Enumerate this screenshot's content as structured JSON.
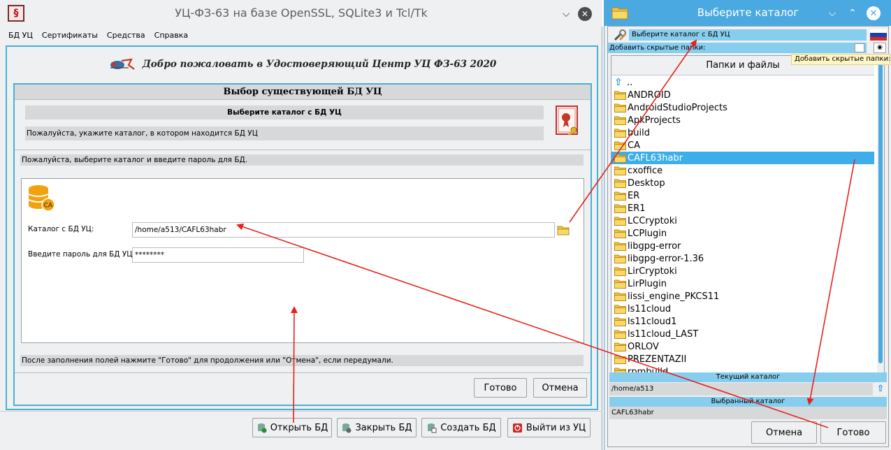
{
  "main_window": {
    "title": "УЦ-ФЗ-63 на базе OpenSSL, SQLite3 и Tcl/Tk",
    "menu": [
      "БД УЦ",
      "Сертификаты",
      "Средства",
      "Справка"
    ],
    "welcome": "Добро пожаловать в Удостоверяющий Центр УЦ ФЗ-63 2020",
    "group_title": "Выбор существующей БД УЦ",
    "hint_title": "Выберите каталог с БД УЦ",
    "hint_sub": "Пожалуйста, укажите каталог, в котором находится БД УЦ",
    "hint_sub2": "Пожалуйста, выберите каталог и введите пароль для БД.",
    "db_badge": "CA",
    "catalog_label": "Каталог с БД УЦ:",
    "catalog_value": "/home/a513/CAFL63habr",
    "password_label": "Введите пароль для БД УЦ:",
    "password_value": "********",
    "hint_bottom": "После заполнения полей нажмите \"Готово\" для продолжения или \"Отмена\", если передумали.",
    "done_button": "Готово",
    "cancel_button": "Отмена",
    "bottom_buttons": [
      "Открыть БД",
      "Закрыть БД",
      "Создать БД",
      "Выйти из УЦ"
    ]
  },
  "dialog": {
    "title": "Выберите каталог",
    "head_label": "Выберите каталог с БД УЦ",
    "hidden_label": "Добавить скрытые папки:",
    "tooltip": "Добавить скрытые папки:",
    "list_header": "Папки и файлы",
    "items": [
      "..",
      "ANDROID",
      "AndroidStudioProjects",
      "ApkProjects",
      "build",
      "CA",
      "CAFL63habr",
      "cxoffice",
      "Desktop",
      "ER",
      "ER1",
      "LCCryptoki",
      "LCPlugin",
      "libgpg-error",
      "libgpg-error-1.36",
      "LirCryptoki",
      "LirPlugin",
      "lissi_engine_PKCS11",
      "ls11cloud",
      "ls11cloud1",
      "ls11cloud_LAST",
      "ORLOV",
      "PREZENTAZII",
      "rpmbuild"
    ],
    "selected_item": "CAFL63habr",
    "current_label": "Текущий каталог",
    "current_value": "/home/a513",
    "chosen_label": "Выбранный каталог",
    "chosen_value": "CAFL63habr",
    "cancel_button": "Отмена",
    "done_button": "Готово"
  },
  "colors": {
    "accent": "#4aa9e0",
    "selection": "#3daee9",
    "section_bar": "#87cdee",
    "annotation_arrow": "#e8201c"
  }
}
